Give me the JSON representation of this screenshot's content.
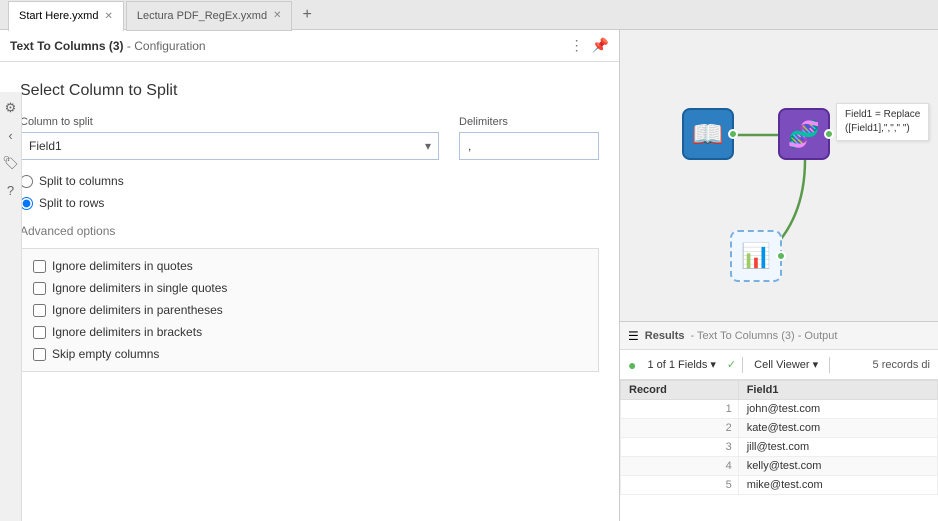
{
  "tabs": [
    {
      "label": "Start Here.yxmd",
      "active": true,
      "closeable": true
    },
    {
      "label": "Lectura PDF_RegEx.yxmd",
      "active": false,
      "closeable": true
    },
    {
      "label": "New",
      "active": false,
      "closeable": false
    }
  ],
  "config": {
    "header_title": "Text To Columns (3)",
    "header_subtitle": " - Configuration",
    "panel_title": "Select Column to Split",
    "column_label": "Column to split",
    "column_value": "Field1",
    "delimiters_label": "Delimiters",
    "delimiters_value": ",",
    "split_columns_label": "Split to columns",
    "split_rows_label": "Split to rows",
    "advanced_label": "Advanced options",
    "options": [
      "Ignore delimiters in quotes",
      "Ignore delimiters in single quotes",
      "Ignore delimiters in parentheses",
      "Ignore delimiters in brackets",
      "Skip empty columns"
    ]
  },
  "canvas": {
    "node1": {
      "icon": "📖",
      "color": "#3a7abf",
      "label": ""
    },
    "node2": {
      "icon": "🧬",
      "color": "#8b5cf6",
      "label": ""
    },
    "node3": {
      "icon": "📊",
      "color": "#2e9e5e",
      "label": ""
    },
    "tooltip": "Field1 = Replace\n([Field1],\",\",\" \")"
  },
  "results": {
    "title": "Results",
    "subtitle": " - Text To Columns (3) - Output",
    "fields_info": "1 of 1 Fields",
    "records_info": "5 records di",
    "viewer_label": "Cell Viewer",
    "columns": [
      "Record",
      "Field1"
    ],
    "rows": [
      {
        "num": "1",
        "value": "john@test.com"
      },
      {
        "num": "2",
        "value": "kate@test.com"
      },
      {
        "num": "3",
        "value": "jill@test.com"
      },
      {
        "num": "4",
        "value": "kelly@test.com"
      },
      {
        "num": "5",
        "value": "mike@test.com"
      }
    ]
  },
  "icons": {
    "ellipsis": "⋮",
    "pin": "📌",
    "settings": "⚙",
    "arrow_left": "‹",
    "arrow_right": "›",
    "tag": "🏷",
    "question": "?",
    "list": "☰",
    "green_dot": "●",
    "chevron_down": "▾",
    "check": "✓"
  }
}
